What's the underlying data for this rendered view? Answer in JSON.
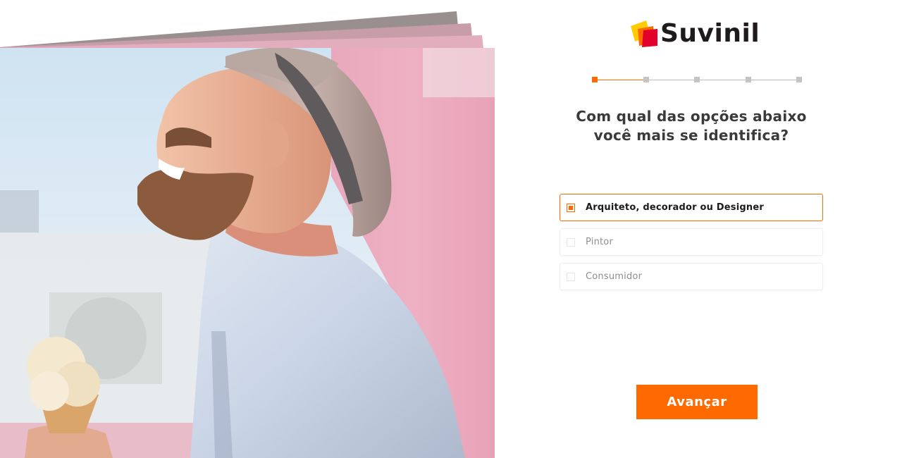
{
  "brand": {
    "name": "Suvinil",
    "accent_color": "#ff6a00",
    "logo_colors": [
      "#ffcc00",
      "#ff6a00",
      "#e3002b"
    ]
  },
  "hero": {
    "icon": "photo-man-laughing-with-ice-cream"
  },
  "progress": {
    "total_steps": 5,
    "current_step": 1
  },
  "question": {
    "line1": "Com qual das opções abaixo",
    "line2": "você mais se identifica?"
  },
  "options": [
    {
      "label": "Arquiteto, decorador ou Designer",
      "selected": true
    },
    {
      "label": "Pintor",
      "selected": false
    },
    {
      "label": "Consumidor",
      "selected": false
    }
  ],
  "actions": {
    "next_label": "Avançar"
  }
}
